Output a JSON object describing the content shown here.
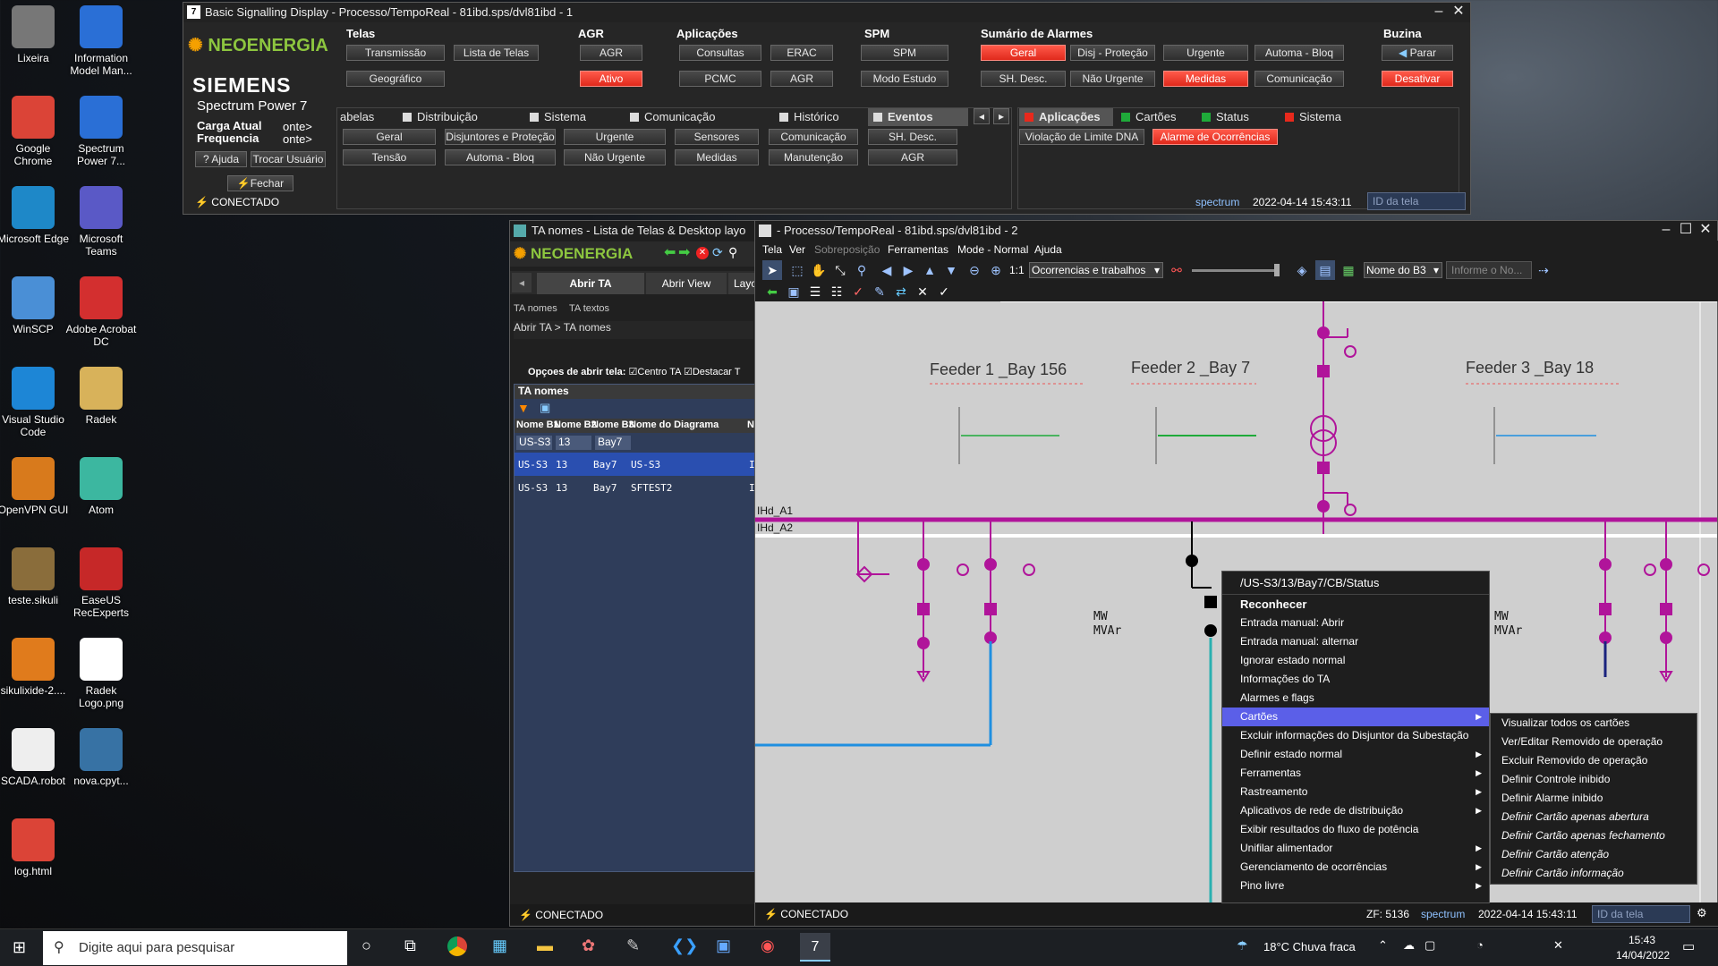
{
  "desktop_icons": [
    {
      "label": "Lixeira",
      "icon": "recycle-bin-icon"
    },
    {
      "label": "Information Model Man...",
      "icon": "info-model-icon"
    },
    {
      "label": "Google Chrome",
      "icon": "chrome-icon"
    },
    {
      "label": "Spectrum Power 7...",
      "icon": "spectrum-icon"
    },
    {
      "label": "Microsoft Edge",
      "icon": "edge-icon"
    },
    {
      "label": "Microsoft Teams",
      "icon": "teams-icon"
    },
    {
      "label": "WinSCP",
      "icon": "winscp-icon"
    },
    {
      "label": "Adobe Acrobat DC",
      "icon": "acrobat-icon"
    },
    {
      "label": "Visual Studio Code",
      "icon": "vscode-icon"
    },
    {
      "label": "Radek",
      "icon": "folder-icon"
    },
    {
      "label": "OpenVPN GUI",
      "icon": "openvpn-icon"
    },
    {
      "label": "Atom",
      "icon": "atom-icon"
    },
    {
      "label": "teste.sikuli",
      "icon": "folder-icon"
    },
    {
      "label": "EaseUS RecExperts",
      "icon": "recorder-icon"
    },
    {
      "label": "sikulixide-2....",
      "icon": "java-icon"
    },
    {
      "label": "Radek Logo.png",
      "icon": "image-icon"
    },
    {
      "label": "SCADA.robot",
      "icon": "file-icon"
    },
    {
      "label": "nova.cpyt...",
      "icon": "python-icon"
    },
    {
      "label": "log.html",
      "icon": "chrome-icon"
    }
  ],
  "w1": {
    "title": "Basic Signalling Display - Processo/TempoReal - 81ibd.sps/dvl81ibd - 1",
    "brand": "NEOENERGIA",
    "siemens": "SIEMENS",
    "product": "Spectrum Power 7",
    "carga": "Carga Atual",
    "freq": "Frequencia",
    "carga_val": "onte>",
    "freq_val": "onte>",
    "ajuda": "Ajuda",
    "trocar": "Trocar Usuário",
    "fechar": "Fechar",
    "telas_label": "Telas",
    "telas": [
      "Transmissão",
      "Lista de Telas",
      "Geográfico"
    ],
    "agr_label": "AGR",
    "agr": [
      "AGR",
      "Ativo"
    ],
    "apl_label": "Aplicações",
    "apl": [
      "Consultas",
      "ERAC",
      "PCMC",
      "AGR"
    ],
    "spm_label": "SPM",
    "spm": [
      "SPM",
      "Modo Estudo"
    ],
    "alarm_label": "Sumário de Alarmes",
    "alarms": [
      "Geral",
      "Disj - Proteção",
      "Urgente",
      "Automa - Bloq",
      "SH. Desc.",
      "Não Urgente",
      "Medidas",
      "Comunicação"
    ],
    "buzina_label": "Buzina",
    "parar": "Parar",
    "desativar": "Desativar",
    "tabs_left": [
      "abelas",
      "Distribuição",
      "Sistema",
      "Comunicação",
      "Histórico",
      "Eventos"
    ],
    "ev_buttons": [
      "Geral",
      "Disjuntores e Proteção",
      "Urgente",
      "Sensores",
      "Comunicação",
      "SH. Desc.",
      "Tensão",
      "Automa - Bloq",
      "Não Urgente",
      "Medidas",
      "Manutenção",
      "AGR"
    ],
    "tabs_right": [
      "Aplicações",
      "Cartões",
      "Status",
      "Sistema"
    ],
    "right_buttons": [
      "Violação de Limite DNA",
      "Alarme de Ocorrências"
    ],
    "status": "CONECTADO",
    "app": "spectrum",
    "time": "2022-04-14 15:43:11",
    "id_placeholder": "ID da tela"
  },
  "w2": {
    "title": "TA nomes - Lista de Telas & Desktop layo",
    "brand": "NEOENERGIA",
    "tabs": [
      "Abrir TA",
      "Abrir View",
      "Layo"
    ],
    "subtabs": [
      "TA nomes",
      "TA textos"
    ],
    "breadcrumb": [
      "Abrir TA",
      "TA nomes"
    ],
    "options_label": "Opçoes de abrir tela:",
    "opt1": "Centro TA",
    "opt2": "Destacar T",
    "section": "TA nomes",
    "columns": [
      "Nome B1",
      "Nome B2",
      "Nome B3",
      "Nome do Diagrama",
      "N"
    ],
    "filter": [
      "US-S3",
      "13",
      "Bay7"
    ],
    "rows": [
      [
        "US-S3",
        "13",
        "Bay7",
        "US-S3",
        "I"
      ],
      [
        "US-S3",
        "13",
        "Bay7",
        "SFTEST2",
        "I"
      ]
    ],
    "status": "CONECTADO"
  },
  "w3": {
    "title": "- Processo/TempoReal - 81ibd.sps/dvl81ibd - 2",
    "menu": [
      "Tela",
      "Ver",
      "Sobreposição",
      "Ferramentas",
      "Mode - Normal",
      "Ajuda"
    ],
    "ratio": "1:1",
    "combo1": "Ocorrencias e trabalhos",
    "combo2": "Nome do B3",
    "input_placeholder": "Informe o No...",
    "feeders": [
      "Feeder 1 _Bay 156",
      "Feeder 2 _Bay 7",
      "Feeder 3 _Bay 18"
    ],
    "buses": [
      "IHd_A1",
      "IHd_A2"
    ],
    "mw": "MW",
    "mvar": "MVAr",
    "status": "CONECTADO",
    "zf": "ZF: 5136",
    "app": "spectrum",
    "time": "2022-04-14 15:43:11",
    "id_placeholder": "ID da tela"
  },
  "context_menu": {
    "header": "/US-S3/13/Bay7/CB/Status",
    "items": [
      "Reconhecer",
      "Entrada manual: Abrir",
      "Entrada manual: alternar",
      "Ignorar estado normal",
      "Informações do TA",
      "Alarmes e flags",
      "Cartões",
      "Excluir informações do Disjuntor da Subestação",
      "Definir estado normal",
      "Ferramentas",
      "Rastreamento",
      "Aplicativos de rede de distribuição",
      "Exibir resultados do fluxo de potência",
      "Unifilar alimentador",
      "Gerenciamento de ocorrências",
      "Pino livre"
    ]
  },
  "submenu": {
    "items": [
      "Visualizar todos os cartões",
      "Ver/Editar Removido de operação",
      "Excluir Removido de operação",
      "Definir Controle inibido",
      "Definir Alarme inibido",
      "Definir Cartão apenas abertura",
      "Definir Cartão apenas fechamento",
      "Definir Cartão atenção",
      "Definir Cartão informação"
    ]
  },
  "taskbar": {
    "search": "Digite aqui para pesquisar",
    "weather": "18°C  Chuva fraca",
    "time": "15:43",
    "date": "14/04/2022"
  },
  "colors": {
    "accent": "#b0149a",
    "red": "#e8291c",
    "green": "#1faa3a",
    "blue": "#1f8fe0"
  }
}
